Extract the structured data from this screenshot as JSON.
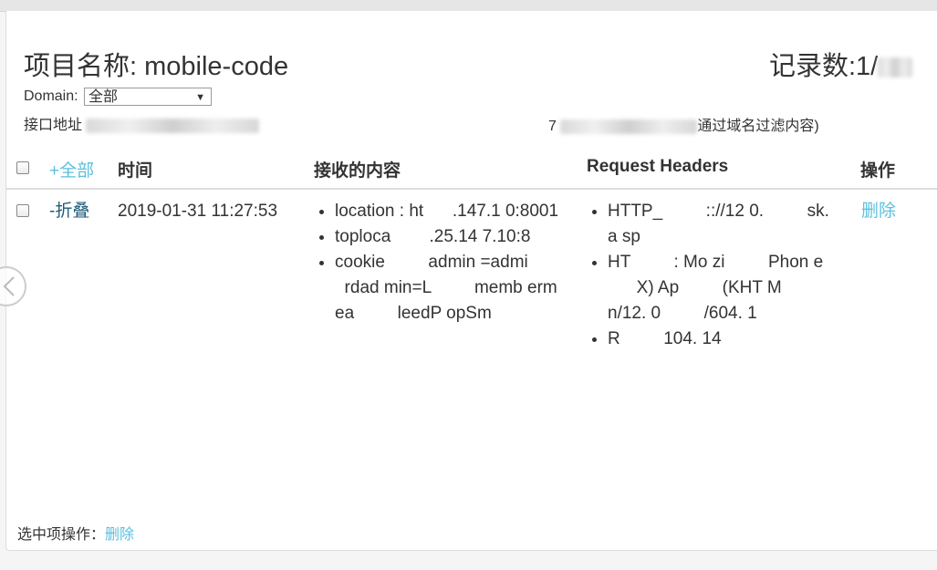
{
  "header": {
    "title": "项目名称: mobile-code",
    "count_label": "记录数:1/"
  },
  "filters": {
    "domain_label": "Domain:",
    "domain_selected": "全部",
    "api_label": "接口地址",
    "note_prefix": "7",
    "note_suffix": "通过域名过滤内容)"
  },
  "table": {
    "headers": {
      "expand_all": "+全部",
      "time": "时间",
      "content": "接收的内容",
      "request_headers": "Request Headers",
      "actions": "操作"
    },
    "rows": [
      {
        "toggle": "-折叠",
        "time": "2019-01-31 11:27:53",
        "content_items": [
          "location : ht      .147.1 0:8001",
          "toploca        .25.14 7.10:8",
          "cookie         admin =admi         rdad min=L         memb ermea         leedP opSm"
        ],
        "header_items": [
          "HTTP_         :://12 0.         sk.a sp",
          "HT         : Mo zi         Phon e         X) Ap         (KHT M         n/12. 0         /604. 1",
          "R         104. 14"
        ],
        "delete_label": "删除"
      }
    ]
  },
  "footer": {
    "label": "选中项操作：",
    "delete_label": "删除"
  },
  "colors": {
    "link": "#5bc0de",
    "link_dark": "#1f5c7a",
    "text": "#333333"
  }
}
